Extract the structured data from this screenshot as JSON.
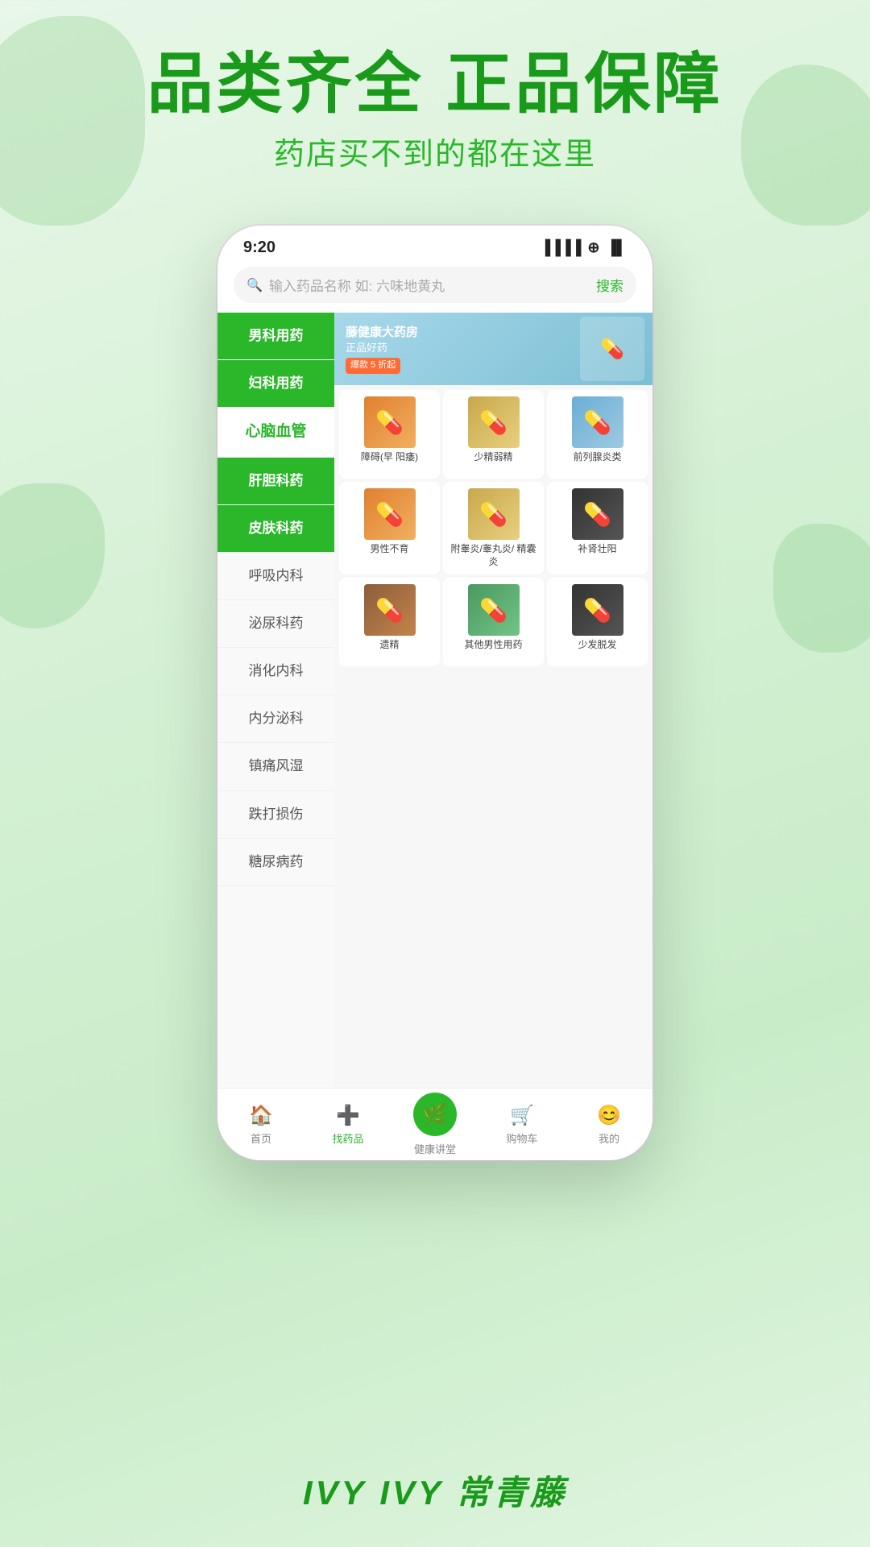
{
  "header": {
    "main_title": "品类齐全 正品保障",
    "sub_title": "药店买不到的都在这里"
  },
  "phone": {
    "status_bar": {
      "time": "9:20",
      "signal": "📶",
      "wifi": "WiFi",
      "battery": "🔋"
    },
    "search": {
      "placeholder": "输入药品名称 如: 六味地黄丸",
      "button": "搜索"
    },
    "sidebar": {
      "items": [
        {
          "label": "男科用药",
          "state": "active-green"
        },
        {
          "label": "妇科用药",
          "state": "active-green"
        },
        {
          "label": "心脑血管",
          "state": "active-white"
        },
        {
          "label": "肝胆科药",
          "state": "active-green"
        },
        {
          "label": "皮肤科药",
          "state": "active-green"
        },
        {
          "label": "呼吸内科",
          "state": "normal"
        },
        {
          "label": "泌尿科药",
          "state": "normal"
        },
        {
          "label": "消化内科",
          "state": "normal"
        },
        {
          "label": "内分泌科",
          "state": "normal"
        },
        {
          "label": "镇痛风湿",
          "state": "normal"
        },
        {
          "label": "跌打损伤",
          "state": "normal"
        },
        {
          "label": "糖尿病药",
          "state": "normal"
        }
      ]
    },
    "banner": {
      "store_name": "藤健康大药房",
      "tagline": "正品好药",
      "badge": "爆款 5 折起"
    },
    "products": [
      {
        "name": "障碍(早\n阳痿)",
        "img_class": "img-orange"
      },
      {
        "name": "少精弱精",
        "img_class": "img-gold"
      },
      {
        "name": "前列腺炎类",
        "img_class": "img-blue"
      },
      {
        "name": "男性不育",
        "img_class": "img-orange"
      },
      {
        "name": "附睾炎/睾丸炎/\n精囊炎",
        "img_class": "img-gold"
      },
      {
        "name": "补肾壮阳",
        "img_class": "img-dark"
      },
      {
        "name": "遗精",
        "img_class": "img-brown"
      },
      {
        "name": "其他男性用药",
        "img_class": "img-green2"
      },
      {
        "name": "少发脱发",
        "img_class": "img-dark"
      }
    ],
    "bottom_nav": [
      {
        "label": "首页",
        "icon": "🏠",
        "active": false,
        "is_center": false
      },
      {
        "label": "找药品",
        "icon": "➕",
        "active": true,
        "is_center": false
      },
      {
        "label": "健康讲堂",
        "icon": "🌿",
        "active": false,
        "is_center": true
      },
      {
        "label": "购物车",
        "icon": "🛒",
        "active": false,
        "is_center": false
      },
      {
        "label": "我的",
        "icon": "😊",
        "active": false,
        "is_center": false
      }
    ]
  },
  "footer": {
    "brand": "IVY 常青藤"
  }
}
